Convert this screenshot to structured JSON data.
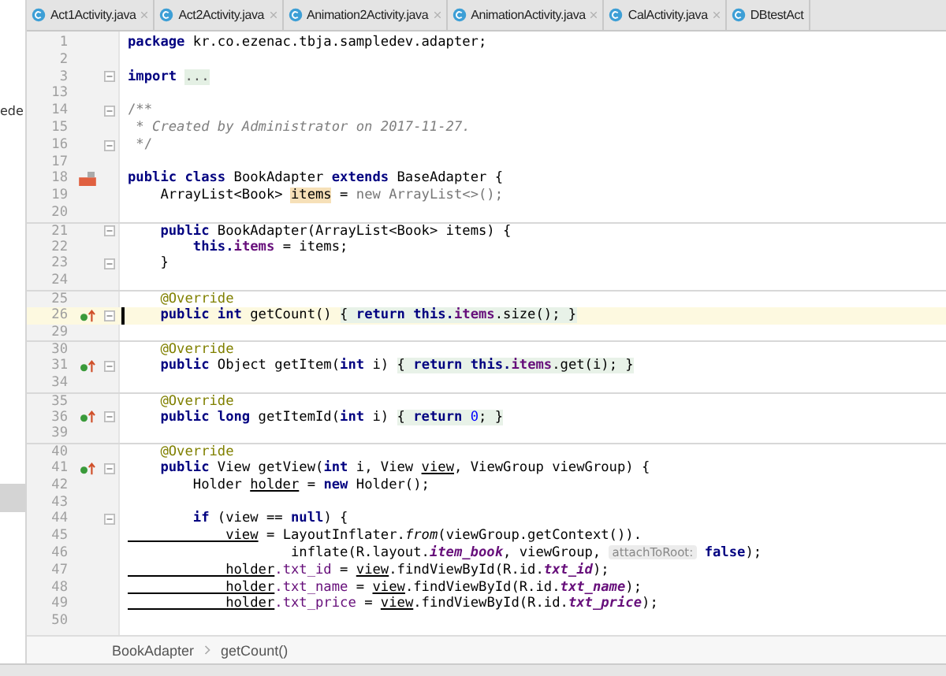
{
  "side_panel": {
    "text": "ede"
  },
  "tabs": [
    {
      "label": "Act1Activity.java",
      "selected": false
    },
    {
      "label": "Act2Activity.java",
      "selected": false
    },
    {
      "label": "Animation2Activity.java",
      "selected": false
    },
    {
      "label": "AnimationActivity.java",
      "selected": false
    },
    {
      "label": "CalActivity.java",
      "selected": false
    },
    {
      "label": "DBtestAct",
      "selected": false
    }
  ],
  "lines": [
    {
      "number": "1",
      "tokens": [
        {
          "text": "package",
          "kind": "keyword"
        },
        {
          "text": " kr.co.ezenac.tbja.sampledev.adapter;",
          "kind": "plain"
        }
      ]
    },
    {
      "number": "2"
    },
    {
      "number": "3",
      "fold": true,
      "tokens": [
        {
          "text": "import ",
          "kind": "keyword"
        },
        {
          "text": "...",
          "kind": "folded"
        }
      ]
    },
    {
      "number": "13"
    },
    {
      "number": "14",
      "fold": true,
      "tokens": [
        {
          "text": "/**",
          "kind": "comment"
        }
      ]
    },
    {
      "number": "15",
      "tokens": [
        {
          "text": " * Created by Administrator on 2017-11-27.",
          "kind": "doc"
        }
      ]
    },
    {
      "number": "16",
      "fold": true,
      "tokens": [
        {
          "text": " */",
          "kind": "comment"
        }
      ]
    },
    {
      "number": "17"
    },
    {
      "number": "18",
      "class_marker": true,
      "tokens": [
        {
          "text": "public class",
          "kind": "keyword"
        },
        {
          "text": " BookAdapter ",
          "kind": "plain"
        },
        {
          "text": "extends",
          "kind": "keyword"
        },
        {
          "text": " BaseAdapter {",
          "kind": "plain"
        }
      ]
    },
    {
      "number": "19",
      "tokens": [
        {
          "text": "    ArrayList<Book> ",
          "kind": "plain"
        },
        {
          "text": "items",
          "kind": "usage"
        },
        {
          "text": " = ",
          "kind": "plain"
        },
        {
          "text": "new ArrayList<>();",
          "kind": "dim"
        }
      ]
    },
    {
      "number": "20"
    },
    {
      "number": "21",
      "divider_above": true,
      "fold": true,
      "tokens": [
        {
          "text": "    public",
          "kind": "keyword"
        },
        {
          "text": " BookAdapter(ArrayList<Book> items) {",
          "kind": "plain"
        }
      ]
    },
    {
      "number": "22",
      "tokens": [
        {
          "text": "        this.",
          "kind": "keyword"
        },
        {
          "text": "items",
          "kind": "field"
        },
        {
          "text": " = items;",
          "kind": "plain"
        }
      ]
    },
    {
      "number": "23",
      "fold": true,
      "tokens": [
        {
          "text": "    }",
          "kind": "plain"
        }
      ]
    },
    {
      "number": "24"
    },
    {
      "number": "25",
      "divider_above": true,
      "tokens": [
        {
          "text": "    @Override",
          "kind": "annotation"
        }
      ]
    },
    {
      "number": "26",
      "current": true,
      "override_marker": true,
      "fold": true,
      "tokens": [
        {
          "text": "    public int",
          "kind": "keyword"
        },
        {
          "text": " getCount() ",
          "kind": "plain"
        },
        {
          "text": "{ ",
          "kind": "fold_body"
        },
        {
          "text": "return this.",
          "kind": "keyword_fold"
        },
        {
          "text": "items",
          "kind": "field_fold"
        },
        {
          "text": ".size(); }",
          "kind": "fold_body"
        }
      ]
    },
    {
      "number": "29"
    },
    {
      "number": "30",
      "divider_above": true,
      "tokens": [
        {
          "text": "    @Override",
          "kind": "annotation"
        }
      ]
    },
    {
      "number": "31",
      "override_marker": true,
      "fold": true,
      "tokens": [
        {
          "text": "    public",
          "kind": "keyword"
        },
        {
          "text": " Object getItem(",
          "kind": "plain"
        },
        {
          "text": "int",
          "kind": "keyword"
        },
        {
          "text": " i) ",
          "kind": "plain"
        },
        {
          "text": "{ ",
          "kind": "fold_body"
        },
        {
          "text": "return this.",
          "kind": "keyword_fold"
        },
        {
          "text": "items",
          "kind": "field_fold"
        },
        {
          "text": ".get(i); }",
          "kind": "fold_body"
        }
      ]
    },
    {
      "number": "34"
    },
    {
      "number": "35",
      "divider_above": true,
      "tokens": [
        {
          "text": "    @Override",
          "kind": "annotation"
        }
      ]
    },
    {
      "number": "36",
      "override_marker": true,
      "fold": true,
      "tokens": [
        {
          "text": "    public long",
          "kind": "keyword"
        },
        {
          "text": " getItemId(",
          "kind": "plain"
        },
        {
          "text": "int",
          "kind": "keyword"
        },
        {
          "text": " i) ",
          "kind": "plain"
        },
        {
          "text": "{ ",
          "kind": "fold_body"
        },
        {
          "text": "return ",
          "kind": "keyword_fold"
        },
        {
          "text": "0",
          "kind": "number_fold"
        },
        {
          "text": "; }",
          "kind": "fold_body"
        }
      ]
    },
    {
      "number": "39"
    },
    {
      "number": "40",
      "divider_above": true,
      "tokens": [
        {
          "text": "    @Override",
          "kind": "annotation"
        }
      ]
    },
    {
      "number": "41",
      "override_marker": true,
      "fold": true,
      "tokens": [
        {
          "text": "    public",
          "kind": "keyword"
        },
        {
          "text": " View getView(",
          "kind": "plain"
        },
        {
          "text": "int",
          "kind": "keyword"
        },
        {
          "text": " i, View ",
          "kind": "plain"
        },
        {
          "text": "view",
          "kind": "underlined"
        },
        {
          "text": ", ViewGroup viewGroup) {",
          "kind": "plain"
        }
      ]
    },
    {
      "number": "42",
      "tokens": [
        {
          "text": "        Holder ",
          "kind": "plain"
        },
        {
          "text": "holder",
          "kind": "underlined"
        },
        {
          "text": " = ",
          "kind": "plain"
        },
        {
          "text": "new",
          "kind": "keyword"
        },
        {
          "text": " Holder();",
          "kind": "plain"
        }
      ]
    },
    {
      "number": "43"
    },
    {
      "number": "44",
      "fold": true,
      "tokens": [
        {
          "text": "        if",
          "kind": "keyword"
        },
        {
          "text": " (view == ",
          "kind": "plain"
        },
        {
          "text": "null",
          "kind": "keyword"
        },
        {
          "text": ") {",
          "kind": "plain"
        }
      ]
    },
    {
      "number": "45",
      "tokens": [
        {
          "text": "            view",
          "kind": "underlined"
        },
        {
          "text": " = LayoutInflater.",
          "kind": "plain"
        },
        {
          "text": "from",
          "kind": "static"
        },
        {
          "text": "(viewGroup.getContext()).",
          "kind": "plain"
        }
      ]
    },
    {
      "number": "46",
      "tokens": [
        {
          "text": "                    inflate(R.layout.",
          "kind": "plain"
        },
        {
          "text": "item_book",
          "kind": "static_field"
        },
        {
          "text": ", viewGroup, ",
          "kind": "plain"
        },
        {
          "text": "attachToRoot:",
          "kind": "hint"
        },
        {
          "text": " false",
          "kind": "keyword"
        },
        {
          "text": ");",
          "kind": "plain"
        }
      ]
    },
    {
      "number": "47",
      "tokens": [
        {
          "text": "            holder",
          "kind": "underlined"
        },
        {
          "text": ".txt_id",
          "kind": "field_plain"
        },
        {
          "text": " = ",
          "kind": "plain"
        },
        {
          "text": "view",
          "kind": "underlined"
        },
        {
          "text": ".findViewById(R.id.",
          "kind": "plain"
        },
        {
          "text": "txt_id",
          "kind": "static_field"
        },
        {
          "text": ");",
          "kind": "plain"
        }
      ]
    },
    {
      "number": "48",
      "tokens": [
        {
          "text": "            holder",
          "kind": "underlined"
        },
        {
          "text": ".txt_name",
          "kind": "field_plain"
        },
        {
          "text": " = ",
          "kind": "plain"
        },
        {
          "text": "view",
          "kind": "underlined"
        },
        {
          "text": ".findViewById(R.id.",
          "kind": "plain"
        },
        {
          "text": "txt_name",
          "kind": "static_field"
        },
        {
          "text": ");",
          "kind": "plain"
        }
      ]
    },
    {
      "number": "49",
      "tokens": [
        {
          "text": "            holder",
          "kind": "underlined"
        },
        {
          "text": ".txt_price",
          "kind": "field_plain"
        },
        {
          "text": " = ",
          "kind": "plain"
        },
        {
          "text": "view",
          "kind": "underlined"
        },
        {
          "text": ".findViewById(R.id.",
          "kind": "plain"
        },
        {
          "text": "txt_price",
          "kind": "static_field"
        },
        {
          "text": ");",
          "kind": "plain"
        }
      ]
    },
    {
      "number": "50"
    }
  ],
  "breadcrumb": [
    "BookAdapter",
    "getCount()"
  ]
}
